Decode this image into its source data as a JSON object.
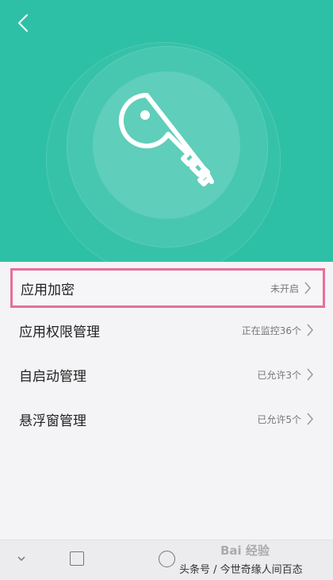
{
  "header": {
    "back_icon": "chevron-left-icon",
    "hero_icon": "key-icon",
    "colors": {
      "hero_bg": "#2ec0a6",
      "highlight_border": "#e66e9c"
    }
  },
  "menu": {
    "items": [
      {
        "label": "应用加密",
        "status": "未开启",
        "highlighted": true
      },
      {
        "label": "应用权限管理",
        "status": "正在监控36个"
      },
      {
        "label": "自启动管理",
        "status": "已允许3个"
      },
      {
        "label": "悬浮窗管理",
        "status": "已允许5个"
      }
    ]
  },
  "navbar": {
    "icons": [
      "chevron-down-icon",
      "square-icon",
      "circle-icon"
    ]
  },
  "watermark": {
    "brand": "Bai 经验",
    "caption": "头条号 / 今世奇缘人间百态"
  }
}
